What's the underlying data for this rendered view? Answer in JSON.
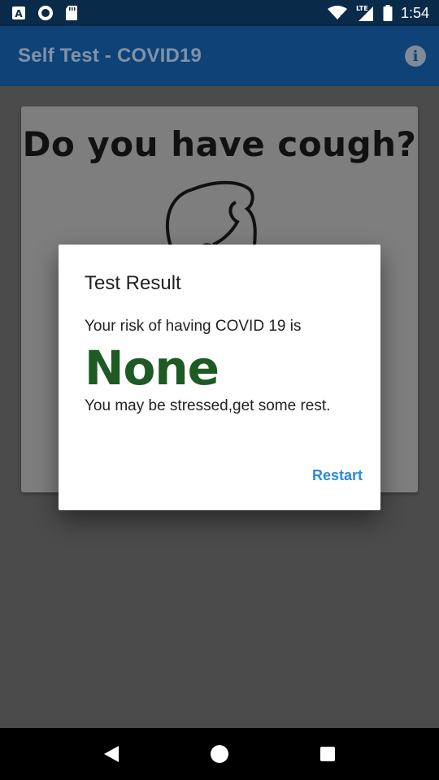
{
  "status_bar": {
    "time": "1:54",
    "network_label": "LTE",
    "icons": [
      "accessibility-icon",
      "circle-app-icon",
      "sd-card-icon",
      "wifi-icon",
      "signal-icon",
      "battery-icon"
    ]
  },
  "app_bar": {
    "title": "Self Test - COVID19",
    "info_icon_glyph": "i"
  },
  "card": {
    "question": "Do you have cough?"
  },
  "dialog": {
    "title": "Test Result",
    "line1": "Your risk of having COVID 19 is",
    "result": "None",
    "line2": "You may be stressed,get some rest.",
    "restart_label": "Restart"
  },
  "colors": {
    "status_bar_bg": "#0a2a4a",
    "app_bar_bg": "#0f4276",
    "result_green": "#1e5a24",
    "accent_blue": "#2a8ad8"
  },
  "nav_bar": {
    "buttons": [
      "back-icon",
      "home-icon",
      "recents-icon"
    ]
  }
}
